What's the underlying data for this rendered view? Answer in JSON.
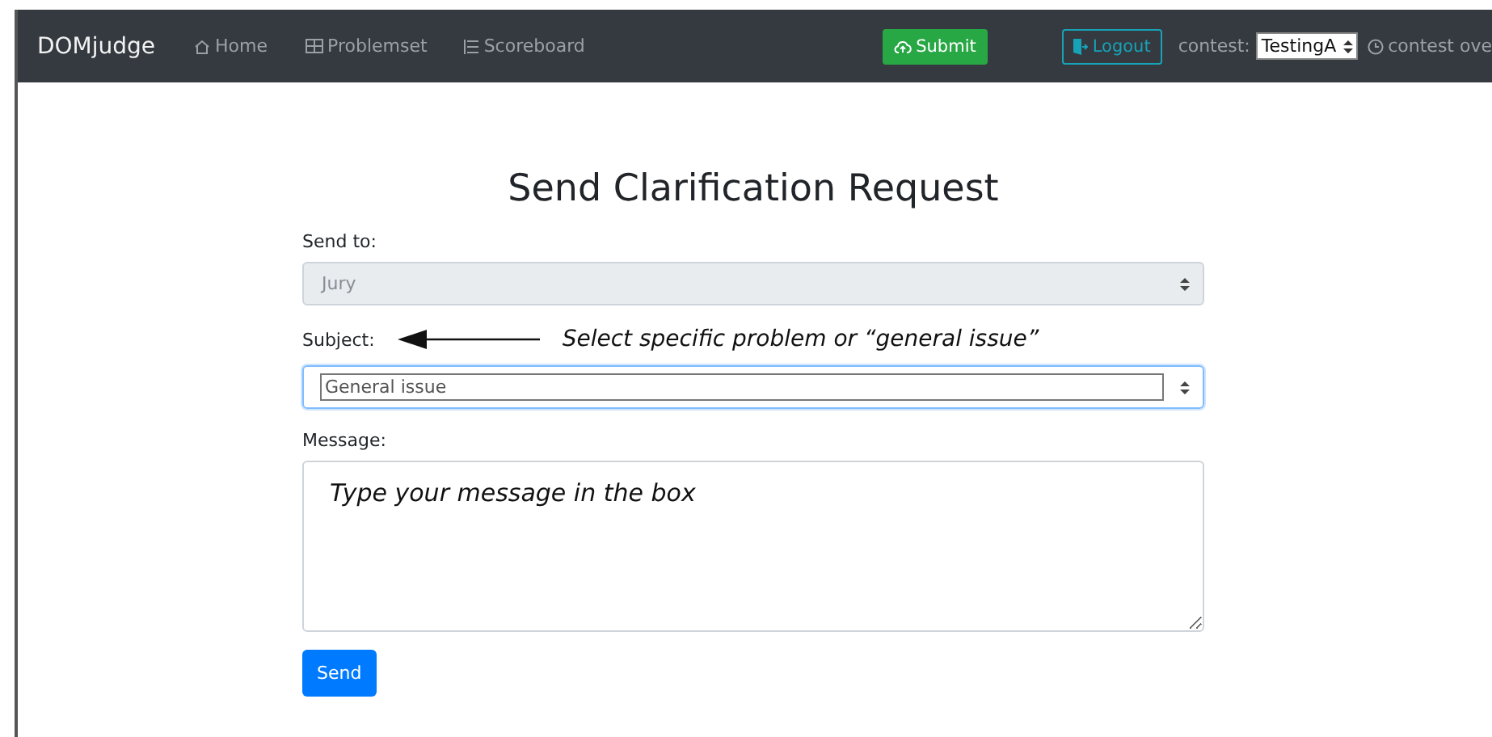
{
  "navbar": {
    "brand": "DOMjudge",
    "links": [
      "Home",
      "Problemset",
      "Scoreboard"
    ],
    "submit_button": "Submit",
    "logout_button": "Logout",
    "contest_label": "contest:",
    "contest_select": "TestingA",
    "contest_status": "contest ove"
  },
  "form": {
    "title": "Send Clarification Request",
    "send_to": {
      "label": "Send to:",
      "value": "Jury",
      "disabled": true
    },
    "subject": {
      "label": "Subject:",
      "value": "General issue",
      "focused": true
    },
    "annotation": "Select specific problem or “general issue”",
    "message": {
      "label": "Message:",
      "value": "Type your message in the box"
    },
    "send_button": "Send"
  }
}
